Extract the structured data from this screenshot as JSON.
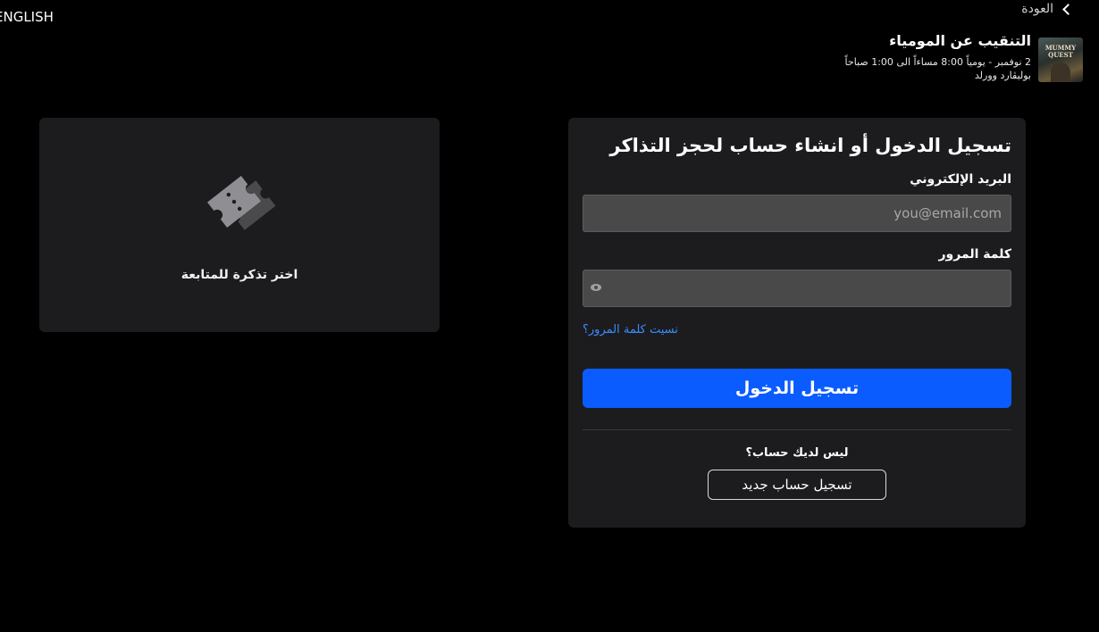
{
  "header": {
    "language_toggle": "ENGLISH",
    "back_label": "العودة"
  },
  "event": {
    "title": "التنقيب عن المومياء",
    "schedule": "2 نوفمبر - يومياً 8:00 مساءاً الى 1:00 صباحاً",
    "venue": "بوليڤارد وورلد",
    "thumbnail_text": "MUMMY QUEST"
  },
  "login": {
    "heading": "تسجيل الدخول أو انشاء حساب لحجز التذاكر",
    "email_label": "البريد الإلكتروني",
    "email_placeholder": "you@email.com",
    "email_value": "",
    "password_label": "كلمة المرور",
    "password_value": "",
    "forgot_password": "نسيت كلمة المرور؟",
    "submit_label": "تسجيل الدخول",
    "no_account_text": "ليس لديك حساب؟",
    "signup_label": "تسجيل حساب جديد"
  },
  "ticket_panel": {
    "caption": "اختر تذكرة للمتابعة",
    "icon": "tickets-icon"
  },
  "colors": {
    "background": "#000000",
    "panel": "#1c1c1e",
    "input": "#494949",
    "primary": "#0a5cff",
    "link": "#3d8bff"
  }
}
